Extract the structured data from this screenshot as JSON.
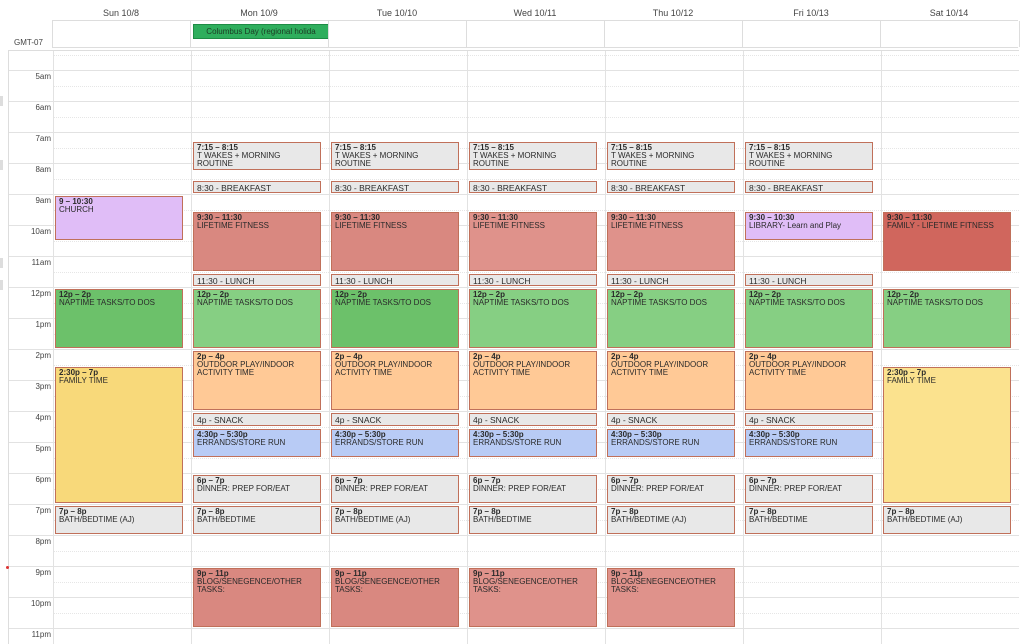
{
  "timezone_label": "GMT-07",
  "days": [
    {
      "label": "Sun 10/8"
    },
    {
      "label": "Mon 10/9"
    },
    {
      "label": "Tue 10/10"
    },
    {
      "label": "Wed 10/11"
    },
    {
      "label": "Thu 10/12"
    },
    {
      "label": "Fri 10/13"
    },
    {
      "label": "Sat 10/14"
    }
  ],
  "all_day_events": [
    {
      "day": 1,
      "title": "Columbus Day (regional holida",
      "color": "#2fae5d"
    }
  ],
  "hours": [
    "5am",
    "6am",
    "7am",
    "8am",
    "9am",
    "10am",
    "11am",
    "12pm",
    "1pm",
    "2pm",
    "3pm",
    "4pm",
    "5pm",
    "6pm",
    "7pm",
    "8pm",
    "9pm",
    "10pm",
    "11pm"
  ],
  "events": [
    {
      "day": 0,
      "start": 9,
      "end": 10.5,
      "time": "9 – 10:30",
      "title": "CHURCH",
      "style": "purple"
    },
    {
      "day": 0,
      "start": 12,
      "end": 14,
      "time": "12p – 2p",
      "title": "NAPTIME TASKS/TO DOS",
      "style": "green"
    },
    {
      "day": 0,
      "start": 14.5,
      "end": 19,
      "time": "2:30p – 7p",
      "title": "FAMILY TIME",
      "style": "yellow"
    },
    {
      "day": 0,
      "start": 19,
      "end": 20,
      "time": "7p – 8p",
      "title": "BATH/BEDTIME (AJ)",
      "style": "gray"
    },
    {
      "day": 1,
      "start": 7.25,
      "end": 8.25,
      "time": "7:15 – 8:15",
      "title": "T WAKES + MORNING ROUTINE",
      "style": "gray"
    },
    {
      "day": 1,
      "start": 8.5,
      "end": 8.9,
      "time": "",
      "title": "8:30 - BREAKFAST",
      "style": "gray"
    },
    {
      "day": 1,
      "start": 9.5,
      "end": 11.5,
      "time": "9:30 – 11:30",
      "title": "LIFETIME FITNESS",
      "style": "red"
    },
    {
      "day": 1,
      "start": 11.5,
      "end": 11.95,
      "time": "",
      "title": "11:30 - LUNCH",
      "style": "gray"
    },
    {
      "day": 1,
      "start": 12,
      "end": 14,
      "time": "12p – 2p",
      "title": "NAPTIME TASKS/TO DOS",
      "style": "green2"
    },
    {
      "day": 1,
      "start": 14,
      "end": 16,
      "time": "2p – 4p",
      "title": "OUTDOOR PLAY/INDOOR ACTIVITY TIME",
      "style": "orange"
    },
    {
      "day": 1,
      "start": 16,
      "end": 16.5,
      "time": "",
      "title": "4p - SNACK",
      "style": "gray"
    },
    {
      "day": 1,
      "start": 16.5,
      "end": 17.5,
      "time": "4:30p – 5:30p",
      "title": "ERRANDS/STORE RUN",
      "style": "blue"
    },
    {
      "day": 1,
      "start": 18,
      "end": 19,
      "time": "6p – 7p",
      "title": "DINNER: PREP FOR/EAT",
      "style": "gray"
    },
    {
      "day": 1,
      "start": 19,
      "end": 20,
      "time": "7p – 8p",
      "title": "BATH/BEDTIME",
      "style": "gray"
    },
    {
      "day": 1,
      "start": 21,
      "end": 23,
      "time": "9p – 11p",
      "title": "BLOG/SENEGENCE/OTHER TASKS:",
      "style": "red"
    },
    {
      "day": 2,
      "start": 7.25,
      "end": 8.25,
      "time": "7:15 – 8:15",
      "title": "T WAKES + MORNING ROUTINE",
      "style": "gray"
    },
    {
      "day": 2,
      "start": 8.5,
      "end": 8.9,
      "time": "",
      "title": "8:30 - BREAKFAST",
      "style": "gray"
    },
    {
      "day": 2,
      "start": 9.5,
      "end": 11.5,
      "time": "9:30 – 11:30",
      "title": "LIFETIME FITNESS",
      "style": "red"
    },
    {
      "day": 2,
      "start": 11.5,
      "end": 11.95,
      "time": "",
      "title": "11:30 - LUNCH",
      "style": "gray"
    },
    {
      "day": 2,
      "start": 12,
      "end": 14,
      "time": "12p – 2p",
      "title": "NAPTIME TASKS/TO DOS",
      "style": "green"
    },
    {
      "day": 2,
      "start": 14,
      "end": 16,
      "time": "2p – 4p",
      "title": "OUTDOOR PLAY/INDOOR ACTIVITY TIME",
      "style": "orange"
    },
    {
      "day": 2,
      "start": 16,
      "end": 16.5,
      "time": "",
      "title": "4p - SNACK",
      "style": "gray"
    },
    {
      "day": 2,
      "start": 16.5,
      "end": 17.5,
      "time": "4:30p – 5:30p",
      "title": "ERRANDS/STORE RUN",
      "style": "blue"
    },
    {
      "day": 2,
      "start": 18,
      "end": 19,
      "time": "6p – 7p",
      "title": "DINNER: PREP FOR/EAT",
      "style": "gray"
    },
    {
      "day": 2,
      "start": 19,
      "end": 20,
      "time": "7p – 8p",
      "title": "BATH/BEDTIME (AJ)",
      "style": "gray"
    },
    {
      "day": 2,
      "start": 21,
      "end": 23,
      "time": "9p – 11p",
      "title": "BLOG/SENEGENCE/OTHER TASKS:",
      "style": "red"
    },
    {
      "day": 3,
      "start": 7.25,
      "end": 8.25,
      "time": "7:15 – 8:15",
      "title": "T WAKES + MORNING ROUTINE",
      "style": "gray"
    },
    {
      "day": 3,
      "start": 8.5,
      "end": 8.9,
      "time": "",
      "title": "8:30 - BREAKFAST",
      "style": "gray"
    },
    {
      "day": 3,
      "start": 9.5,
      "end": 11.5,
      "time": "9:30 – 11:30",
      "title": "LIFETIME FITNESS",
      "style": "red2"
    },
    {
      "day": 3,
      "start": 11.5,
      "end": 11.95,
      "time": "",
      "title": "11:30 - LUNCH",
      "style": "gray"
    },
    {
      "day": 3,
      "start": 12,
      "end": 14,
      "time": "12p – 2p",
      "title": "NAPTIME TASKS/TO DOS",
      "style": "green2"
    },
    {
      "day": 3,
      "start": 14,
      "end": 16,
      "time": "2p – 4p",
      "title": "OUTDOOR PLAY/INDOOR ACTIVITY TIME",
      "style": "orange"
    },
    {
      "day": 3,
      "start": 16,
      "end": 16.5,
      "time": "",
      "title": "4p - SNACK",
      "style": "gray"
    },
    {
      "day": 3,
      "start": 16.5,
      "end": 17.5,
      "time": "4:30p – 5:30p",
      "title": "ERRANDS/STORE RUN",
      "style": "blue"
    },
    {
      "day": 3,
      "start": 18,
      "end": 19,
      "time": "6p – 7p",
      "title": "DINNER: PREP FOR/EAT",
      "style": "gray"
    },
    {
      "day": 3,
      "start": 19,
      "end": 20,
      "time": "7p – 8p",
      "title": "BATH/BEDTIME",
      "style": "gray"
    },
    {
      "day": 3,
      "start": 21,
      "end": 23,
      "time": "9p – 11p",
      "title": "BLOG/SENEGENCE/OTHER TASKS:",
      "style": "red2"
    },
    {
      "day": 4,
      "start": 7.25,
      "end": 8.25,
      "time": "7:15 – 8:15",
      "title": "T WAKES + MORNING ROUTINE",
      "style": "gray"
    },
    {
      "day": 4,
      "start": 8.5,
      "end": 8.9,
      "time": "",
      "title": "8:30 - BREAKFAST",
      "style": "gray"
    },
    {
      "day": 4,
      "start": 9.5,
      "end": 11.5,
      "time": "9:30 – 11:30",
      "title": "LIFETIME FITNESS",
      "style": "red2"
    },
    {
      "day": 4,
      "start": 11.5,
      "end": 11.95,
      "time": "",
      "title": "11:30 - LUNCH",
      "style": "gray"
    },
    {
      "day": 4,
      "start": 12,
      "end": 14,
      "time": "12p – 2p",
      "title": "NAPTIME TASKS/TO DOS",
      "style": "green2"
    },
    {
      "day": 4,
      "start": 14,
      "end": 16,
      "time": "2p – 4p",
      "title": "OUTDOOR PLAY/INDOOR ACTIVITY TIME",
      "style": "orange"
    },
    {
      "day": 4,
      "start": 16,
      "end": 16.5,
      "time": "",
      "title": "4p - SNACK",
      "style": "gray"
    },
    {
      "day": 4,
      "start": 16.5,
      "end": 17.5,
      "time": "4:30p – 5:30p",
      "title": "ERRANDS/STORE RUN",
      "style": "blue"
    },
    {
      "day": 4,
      "start": 18,
      "end": 19,
      "time": "6p – 7p",
      "title": "DINNER: PREP FOR/EAT",
      "style": "gray"
    },
    {
      "day": 4,
      "start": 19,
      "end": 20,
      "time": "7p – 8p",
      "title": "BATH/BEDTIME (AJ)",
      "style": "gray"
    },
    {
      "day": 4,
      "start": 21,
      "end": 23,
      "time": "9p – 11p",
      "title": "BLOG/SENEGENCE/OTHER TASKS:",
      "style": "red2"
    },
    {
      "day": 5,
      "start": 7.25,
      "end": 8.25,
      "time": "7:15 – 8:15",
      "title": "T WAKES + MORNING ROUTINE",
      "style": "gray"
    },
    {
      "day": 5,
      "start": 8.5,
      "end": 8.9,
      "time": "",
      "title": "8:30 - BREAKFAST",
      "style": "gray"
    },
    {
      "day": 5,
      "start": 9.5,
      "end": 10.5,
      "time": "9:30 – 10:30",
      "title": "LIBRARY- Learn and Play",
      "style": "purple"
    },
    {
      "day": 5,
      "start": 11.5,
      "end": 11.95,
      "time": "",
      "title": "11:30 - LUNCH",
      "style": "gray"
    },
    {
      "day": 5,
      "start": 12,
      "end": 14,
      "time": "12p – 2p",
      "title": "NAPTIME TASKS/TO DOS",
      "style": "green2"
    },
    {
      "day": 5,
      "start": 14,
      "end": 16,
      "time": "2p – 4p",
      "title": "OUTDOOR PLAY/INDOOR ACTIVITY TIME",
      "style": "orange"
    },
    {
      "day": 5,
      "start": 16,
      "end": 16.5,
      "time": "",
      "title": "4p - SNACK",
      "style": "gray"
    },
    {
      "day": 5,
      "start": 16.5,
      "end": 17.5,
      "time": "4:30p – 5:30p",
      "title": "ERRANDS/STORE RUN",
      "style": "blue"
    },
    {
      "day": 5,
      "start": 18,
      "end": 19,
      "time": "6p – 7p",
      "title": "DINNER: PREP FOR/EAT",
      "style": "gray"
    },
    {
      "day": 5,
      "start": 19,
      "end": 20,
      "time": "7p – 8p",
      "title": "BATH/BEDTIME",
      "style": "gray"
    },
    {
      "day": 6,
      "start": 9.5,
      "end": 11.5,
      "time": "9:30 – 11:30",
      "title": "FAMILY - LIFETIME FITNESS",
      "style": "red3"
    },
    {
      "day": 6,
      "start": 12,
      "end": 14,
      "time": "12p – 2p",
      "title": "NAPTIME TASKS/TO DOS",
      "style": "green2"
    },
    {
      "day": 6,
      "start": 14.5,
      "end": 19,
      "time": "2:30p – 7p",
      "title": "FAMILY TIME",
      "style": "yellow2"
    },
    {
      "day": 6,
      "start": 19,
      "end": 20,
      "time": "7p – 8p",
      "title": "BATH/BEDTIME (AJ)",
      "style": "gray"
    }
  ]
}
